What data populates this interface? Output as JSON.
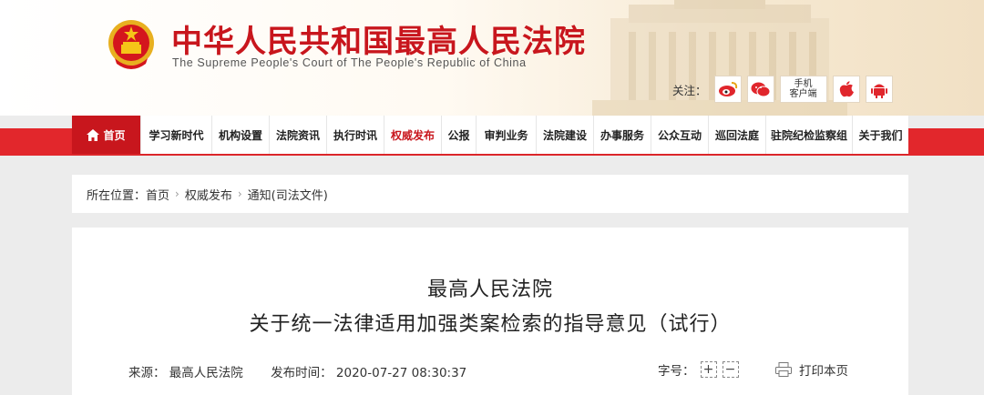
{
  "header": {
    "title": "中华人民共和国最高人民法院",
    "subtitle": "The Supreme People's Court of The People's Republic of China",
    "follow_label": "关注：",
    "mobile_line1": "手机",
    "mobile_line2": "客户端"
  },
  "nav": {
    "items": [
      {
        "label": "首页"
      },
      {
        "label": "学习新时代"
      },
      {
        "label": "机构设置"
      },
      {
        "label": "法院资讯"
      },
      {
        "label": "执行时讯"
      },
      {
        "label": "权威发布"
      },
      {
        "label": "公报"
      },
      {
        "label": "审判业务"
      },
      {
        "label": "法院建设"
      },
      {
        "label": "办事服务"
      },
      {
        "label": "公众互动"
      },
      {
        "label": "巡回法庭"
      },
      {
        "label": "驻院纪检监察组"
      },
      {
        "label": "关于我们"
      }
    ]
  },
  "breadcrumb": {
    "prefix": "所在位置：",
    "items": [
      "首页",
      "权威发布",
      "通知(司法文件)"
    ]
  },
  "article": {
    "title_line1": "最高人民法院",
    "title_line2": "关于统一法律适用加强类案检索的指导意见（试行）",
    "source": "来源：  最高人民法院",
    "published": "发布时间：  2020-07-27 08:30:37",
    "fontsize_label": "字号：",
    "increase": "+",
    "decrease": "−",
    "print_label": "打印本页"
  },
  "colors": {
    "brand_red": "#c8161d",
    "nav_band_red": "#e2272c"
  }
}
